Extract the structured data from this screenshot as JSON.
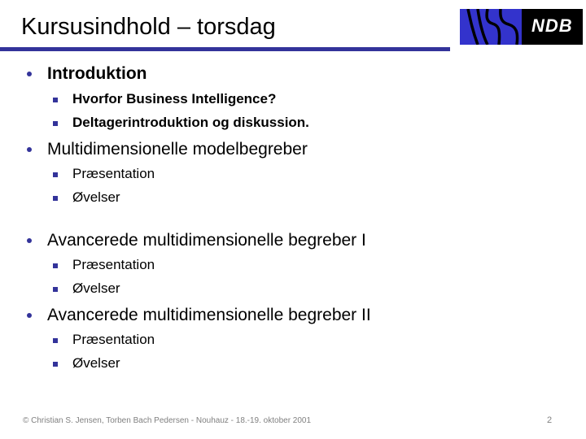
{
  "slide": {
    "title": "Kursusindhold – torsdag",
    "accent_color": "#33339a",
    "bullet_color": "#33339a",
    "rule_color": "#33339a"
  },
  "logo": {
    "name": "ndb-logo",
    "text": "NDB",
    "blue_color": "#3333cc",
    "black_color": "#000000",
    "text_color": "#ffffff"
  },
  "outline": [
    {
      "label": "Introduktion",
      "bold": true,
      "sub": [
        {
          "label": "Hvorfor Business Intelligence?",
          "bold": true
        },
        {
          "label": "Deltagerintroduktion og diskussion.",
          "bold": true
        }
      ]
    },
    {
      "label": "Multidimensionelle modelbegreber",
      "bold": false,
      "sub": [
        {
          "label": "Præsentation",
          "bold": false
        },
        {
          "label": "Øvelser",
          "bold": false
        }
      ]
    },
    {
      "label": "Avancerede multidimensionelle begreber I",
      "bold": false,
      "sub": [
        {
          "label": "Præsentation",
          "bold": false
        },
        {
          "label": "Øvelser",
          "bold": false
        }
      ]
    },
    {
      "label": "Avancerede multidimensionelle begreber II",
      "bold": false,
      "sub": [
        {
          "label": "Præsentation",
          "bold": false
        },
        {
          "label": "Øvelser",
          "bold": false
        }
      ]
    }
  ],
  "footer": {
    "credit": "© Christian S. Jensen, Torben Bach Pedersen - Nouhauz -  18.-19. oktober 2001",
    "page_number": "2"
  }
}
